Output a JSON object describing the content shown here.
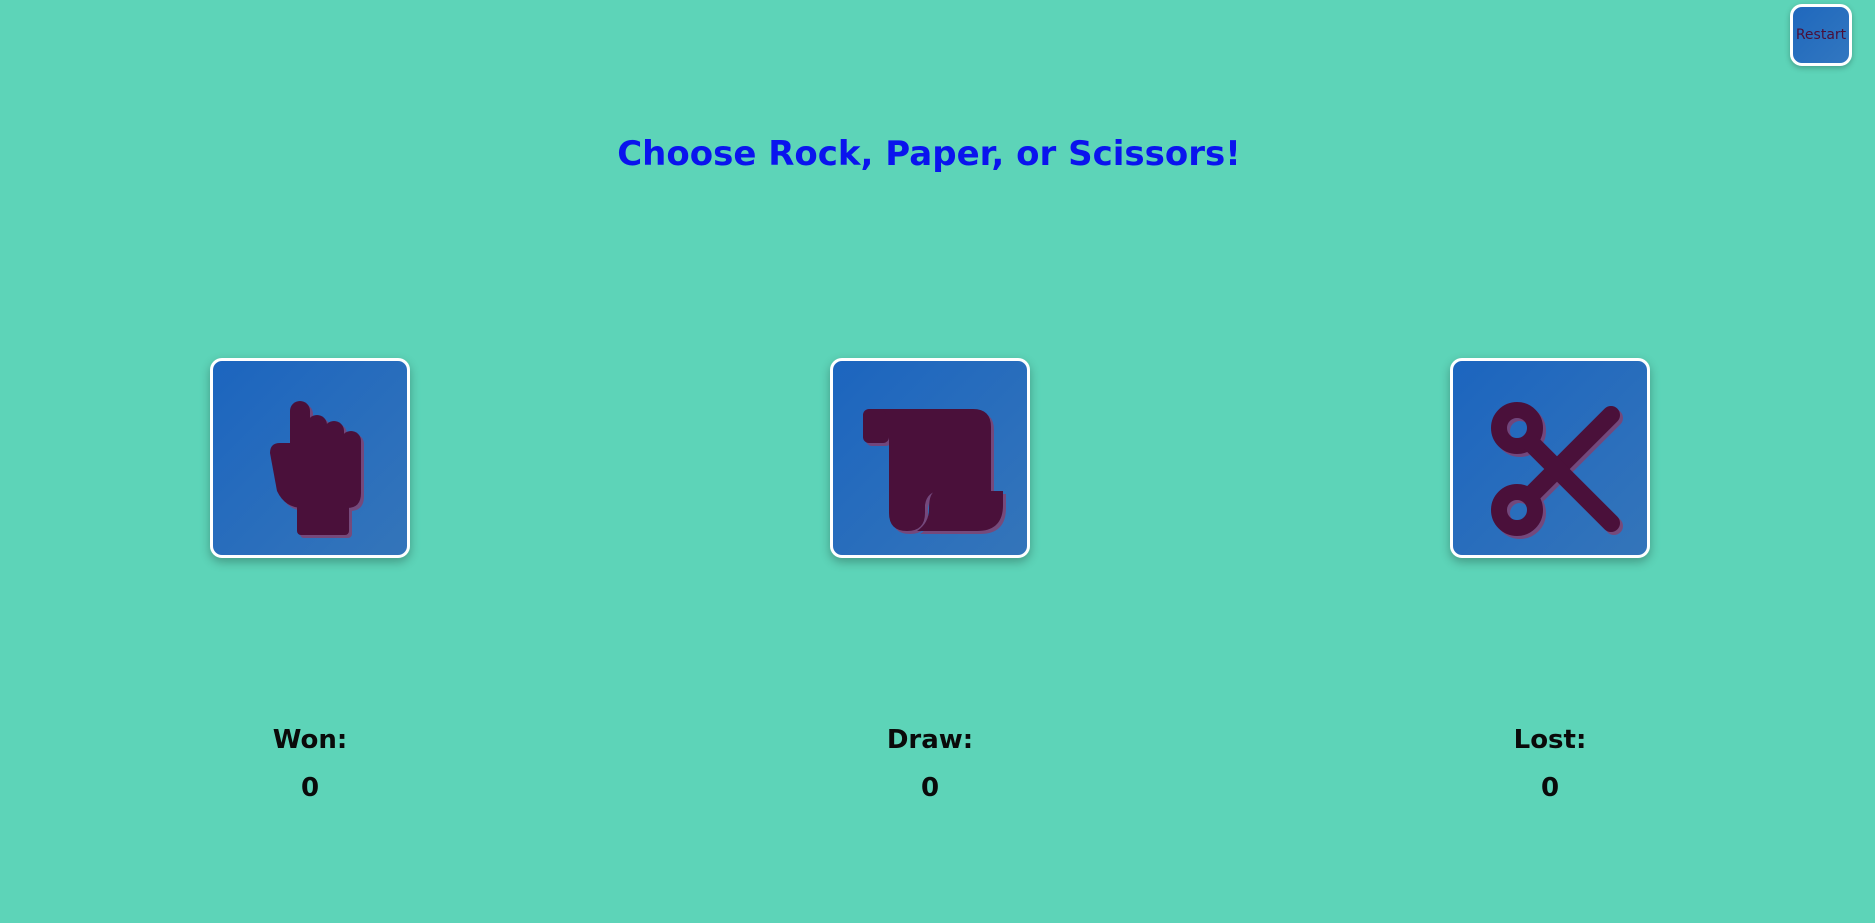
{
  "header": {
    "restart_label": "Restart"
  },
  "prompt": {
    "title": "Choose Rock, Paper, or Scissors!"
  },
  "choices": [
    {
      "id": "rock",
      "icon": "hand-fist-icon"
    },
    {
      "id": "paper",
      "icon": "scroll-icon"
    },
    {
      "id": "scissors",
      "icon": "scissors-icon"
    }
  ],
  "scoreboard": {
    "won": {
      "label": "Won:",
      "value": "0"
    },
    "draw": {
      "label": "Draw:",
      "value": "0"
    },
    "lost": {
      "label": "Lost:",
      "value": "0"
    }
  },
  "colors": {
    "background": "#5dd4b8",
    "card": "#2270bd",
    "icon": "#4a103a",
    "title": "#0a14ee"
  }
}
